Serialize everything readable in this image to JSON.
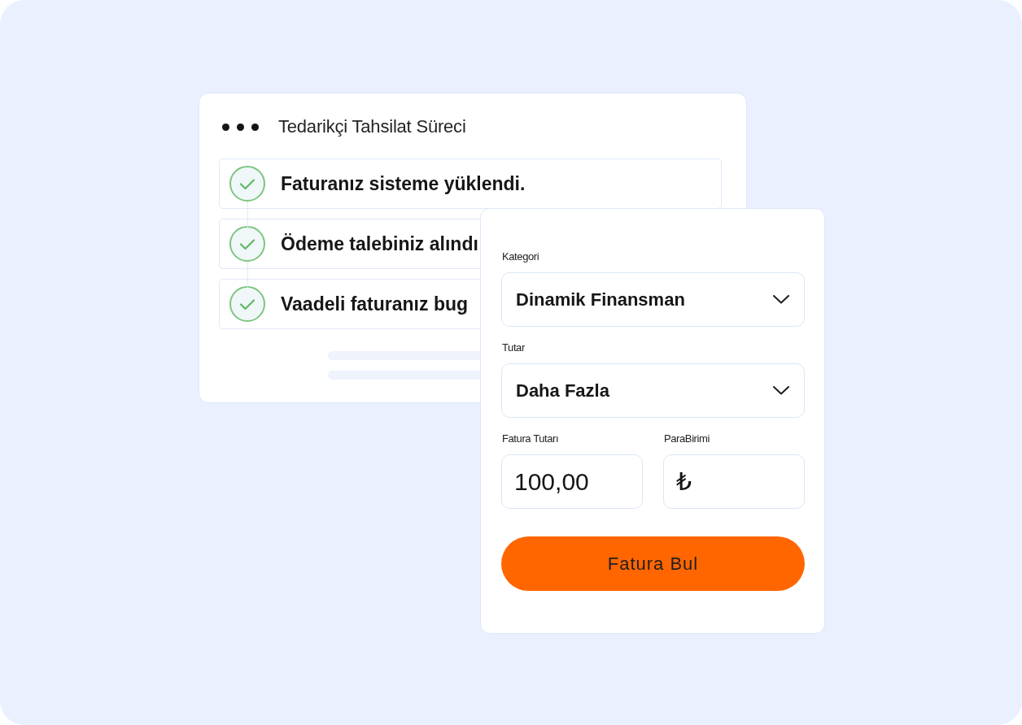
{
  "process_card": {
    "title": "Tedarikçi Tahsilat Süreci",
    "steps": [
      {
        "label": "Faturanız sisteme yüklendi.",
        "completed": true
      },
      {
        "label": "Ödeme talebiniz alındı",
        "completed": true
      },
      {
        "label": "Vaadeli faturanız bug",
        "completed": true
      }
    ]
  },
  "form": {
    "fields": [
      {
        "kind": "select",
        "label": "Kategori",
        "value": "Dinamik Finansman"
      },
      {
        "kind": "select",
        "label": "Tutar",
        "value": "Daha Fazla"
      },
      {
        "kind": "input",
        "label": "Fatura Tutarı",
        "value": "100,00"
      },
      {
        "kind": "input",
        "label": "ParaBirimi",
        "value": "₺"
      }
    ],
    "submit_button": "Fatura Bul"
  }
}
